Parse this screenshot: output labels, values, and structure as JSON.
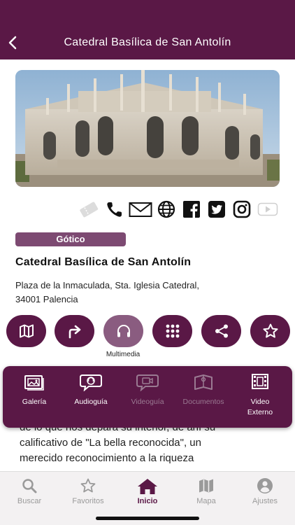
{
  "header": {
    "title": "Catedral Basílica de San  Antolín",
    "back_icon": "back-arrow-icon"
  },
  "hero": {
    "image": "cathedral-photo"
  },
  "contact_icons": [
    "ticket-icon",
    "phone-icon",
    "email-icon",
    "web-icon",
    "facebook-icon",
    "twitter-icon",
    "instagram-icon",
    "youtube-icon"
  ],
  "place": {
    "style_tag": "Gótico",
    "name": "Catedral Basílica de San  Antolín",
    "address_line1": "Plaza de la Inmaculada, Sta. Iglesia Catedral,",
    "address_line2": "34001 Palencia"
  },
  "actions": {
    "items": [
      "map-icon",
      "route-icon",
      "headphones-icon",
      "grid-icon",
      "share-icon",
      "star-icon"
    ],
    "active_label": "Multimedia"
  },
  "multimedia": {
    "items": [
      {
        "label": "Galería",
        "enabled": true
      },
      {
        "label": "Audioguía",
        "enabled": true
      },
      {
        "label": "Videoguía",
        "enabled": false
      },
      {
        "label": "Documentos",
        "enabled": false
      },
      {
        "label_line1": "Video",
        "label_line2": "Externo",
        "enabled": true
      }
    ]
  },
  "body_text": {
    "line1": "de lo que nos depara su interior, de ahí su",
    "line2": "calificativo de \"La bella reconocida\", un",
    "line3": "merecido reconocimiento a la riqueza"
  },
  "tabbar": {
    "items": [
      {
        "label": "Buscar",
        "icon": "search-icon"
      },
      {
        "label": "Favoritos",
        "icon": "star-icon"
      },
      {
        "label": "Inicio",
        "icon": "home-icon",
        "active": true
      },
      {
        "label": "Mapa",
        "icon": "map-icon"
      },
      {
        "label": "Ajustes",
        "icon": "user-icon"
      }
    ]
  },
  "colors": {
    "primary": "#5a1846",
    "tag": "#7d4a72",
    "active_action": "#8a5c80",
    "disabled": "#9a7a92"
  }
}
